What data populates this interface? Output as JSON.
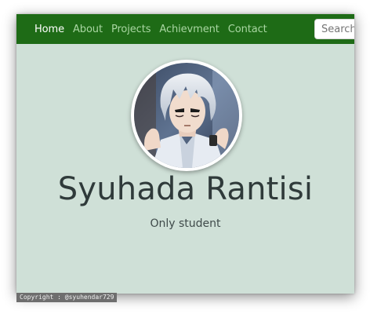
{
  "navbar": {
    "background": "#1e6b16",
    "links": [
      {
        "label": "Home",
        "active": true
      },
      {
        "label": "About",
        "active": false
      },
      {
        "label": "Projects",
        "active": false
      },
      {
        "label": "Achievment",
        "active": false
      },
      {
        "label": "Contact",
        "active": false
      }
    ],
    "search": {
      "placeholder": "Search"
    }
  },
  "hero": {
    "background": "#cfe0d7",
    "avatar_icon": "anime-character-avatar",
    "name": "Syuhada Rantisi",
    "tagline": "Only student"
  },
  "footer": {
    "copyright": "Copyright : @syuhendar729"
  }
}
